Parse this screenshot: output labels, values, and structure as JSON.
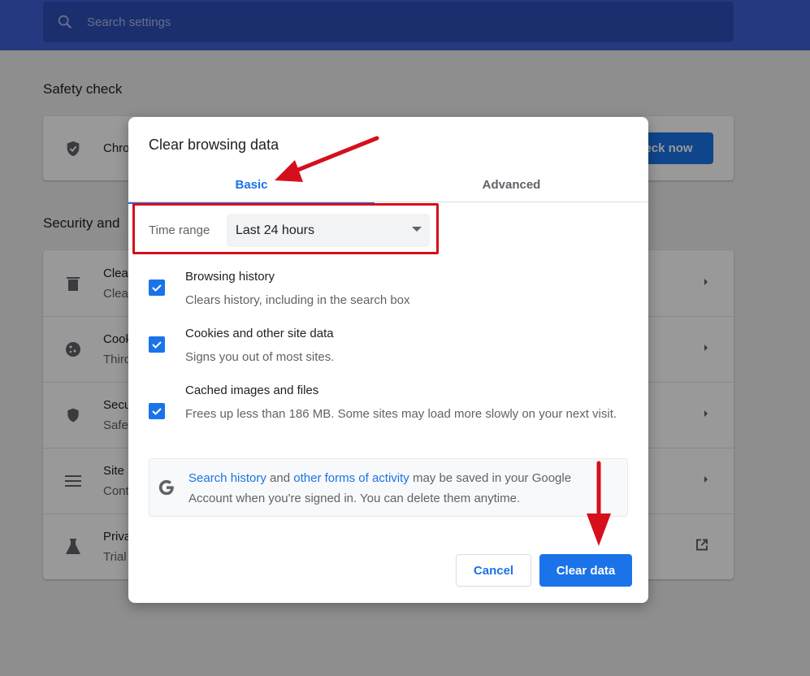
{
  "search": {
    "placeholder": "Search settings"
  },
  "background": {
    "safety_title": "Safety check",
    "safety_row_text": "Chro",
    "check_now_label": "eck now",
    "security_title": "Security and",
    "rows": [
      {
        "title": "Clear",
        "sub": "Clear",
        "icon": "trash-icon"
      },
      {
        "title": "Cook",
        "sub": "Third",
        "icon": "cookie-icon"
      },
      {
        "title": "Secu",
        "sub": "Safe",
        "icon": "shield-icon"
      },
      {
        "title": "Site S",
        "sub": "Cont",
        "icon": "tune-icon"
      },
      {
        "title": "Priva",
        "sub": "Trial",
        "icon": "flask-icon"
      }
    ]
  },
  "dialog": {
    "title": "Clear browsing data",
    "tabs": {
      "basic": "Basic",
      "advanced": "Advanced"
    },
    "time_range": {
      "label": "Time range",
      "value": "Last 24 hours"
    },
    "options": [
      {
        "title": "Browsing history",
        "desc": "Clears history, including in the search box",
        "checked": true
      },
      {
        "title": "Cookies and other site data",
        "desc": "Signs you out of most sites.",
        "checked": true
      },
      {
        "title": "Cached images and files",
        "desc": "Frees up less than 186 MB. Some sites may load more slowly on your next visit.",
        "checked": true
      }
    ],
    "google_notice": {
      "link1": "Search history",
      "and": " and ",
      "link2": "other forms of activity",
      "rest": " may be saved in your Google Account when you're signed in. You can delete them anytime."
    },
    "buttons": {
      "cancel": "Cancel",
      "clear": "Clear data"
    }
  },
  "colors": {
    "accent": "#1a73e8",
    "annotation_red": "#d60f1c"
  }
}
